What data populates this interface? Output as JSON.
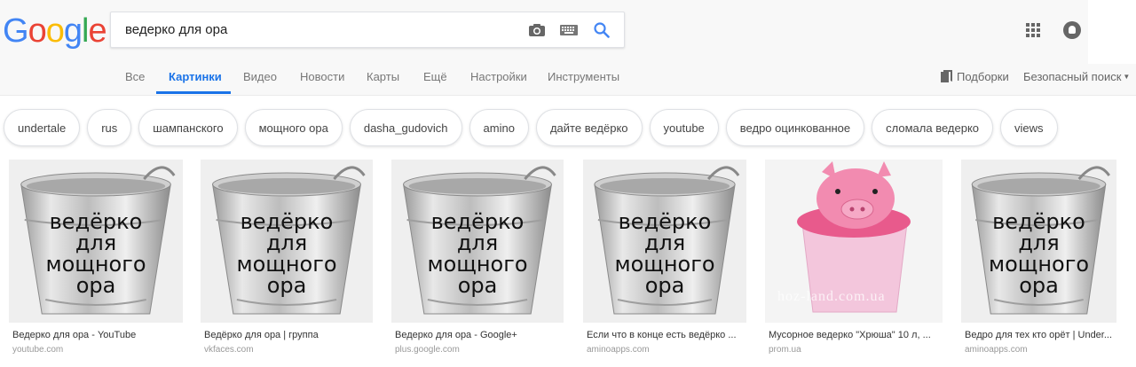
{
  "header": {
    "logo": [
      "G",
      "o",
      "o",
      "g",
      "l",
      "e"
    ],
    "logo_colors": [
      "#4285F4",
      "#EA4335",
      "#FBBC05",
      "#4285F4",
      "#34A853",
      "#EA4335"
    ],
    "search_value": "ведерко для ора",
    "icons": [
      "camera-icon",
      "keyboard-icon",
      "search-icon",
      "apps-icon",
      "avatar"
    ]
  },
  "tabs": {
    "items": [
      "Все",
      "Картинки",
      "Видео",
      "Новости",
      "Карты",
      "Ещё",
      "Настройки",
      "Инструменты"
    ],
    "active": "Картинки",
    "collections": "Подборки",
    "safe_search": "Безопасный поиск"
  },
  "chips": [
    "undertale",
    "rus",
    "шампанского",
    "мощного ора",
    "dasha_gudovich",
    "amino",
    "дайте ведёрко",
    "youtube",
    "ведро оцинкованное",
    "сломала ведерко",
    "views"
  ],
  "results": [
    {
      "title": "Ведерко для ора - YouTube",
      "url": "youtube.com",
      "overlay": "ведёрко\nдля\nмощного\nора",
      "kind": "bucket"
    },
    {
      "title": "Ведёрко для ора | группа",
      "url": "vkfaces.com",
      "overlay": "ведёрко\nдля\nмощного\nора",
      "kind": "bucket"
    },
    {
      "title": "Ведерко для ора - Google+",
      "url": "plus.google.com",
      "overlay": "ведёрко\nдля\nмощного\nора",
      "kind": "bucket"
    },
    {
      "title": "Если что в конце есть ведёрко ...",
      "url": "aminoapps.com",
      "overlay": "ведёрко\nдля\nмощного\nора",
      "kind": "bucket"
    },
    {
      "title": "Мусорное ведерко \"Хрюша\" 10 л, ...",
      "url": "prom.ua",
      "overlay": "",
      "watermark": "hoz-land.com.ua",
      "kind": "pig"
    },
    {
      "title": "Ведро для тех кто орёт | Under...",
      "url": "aminoapps.com",
      "overlay": "ведёрко\nдля\nмощного\nора",
      "kind": "bucket"
    }
  ],
  "colors": {
    "accent": "#1a73e8",
    "chip_border": "#dfe1e5",
    "pig_pink": "#e85a8c",
    "pig_light": "#f3c6dc"
  }
}
